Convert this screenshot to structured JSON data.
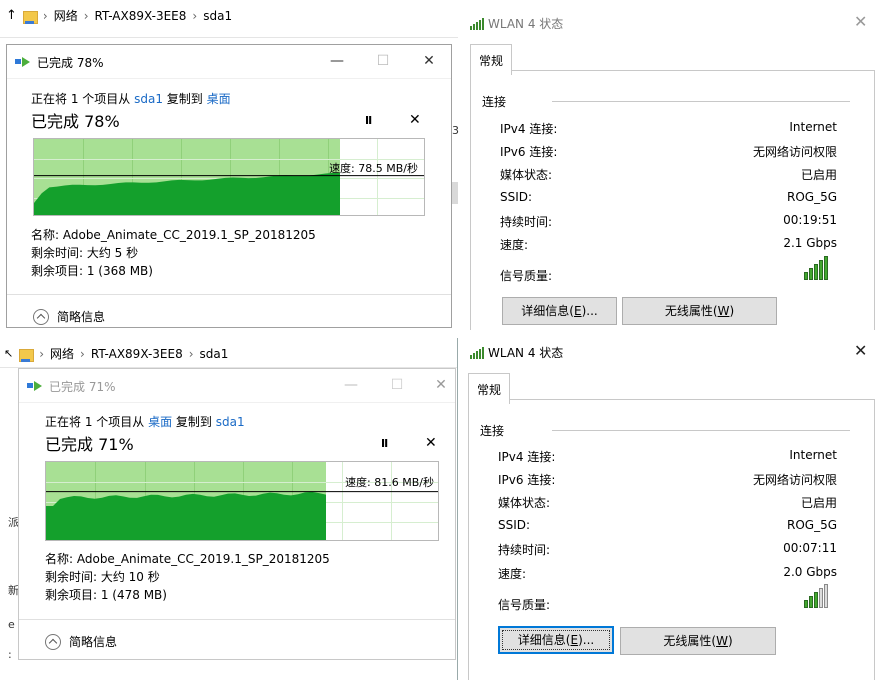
{
  "top": {
    "explorer": {
      "up_glyph": "↑",
      "crumbs": [
        "网络",
        "RT-AX89X-3EE8",
        "sda1"
      ]
    },
    "copy": {
      "title": "已完成 78%",
      "line_pre": "正在将 1 个项目从 ",
      "src": "sda1",
      "mid": " 复制到 ",
      "dst": "桌面",
      "big": "已完成 78%",
      "progress": 0.78,
      "speed_label": "速度: 78.5 MB/秒",
      "name": "名称: Adobe_Animate_CC_2019.1_SP_20181205",
      "remain_time": "剩余时间: 大约 5 秒",
      "remain_items": "剩余项目: 1 (368 MB)",
      "less_label": "简略信息",
      "minimize": "—",
      "maximize": "☐",
      "close": "✕",
      "pause": "II",
      "cancel": "✕"
    },
    "wlan": {
      "title": "WLAN 4 状态",
      "close": "✕",
      "tab": "常规",
      "group": "连接",
      "rows": [
        {
          "label": "IPv4 连接:",
          "value": "Internet"
        },
        {
          "label": "IPv6 连接:",
          "value": "无网络访问权限"
        },
        {
          "label": "媒体状态:",
          "value": "已启用"
        },
        {
          "label": "SSID:",
          "value": "ROG_5G"
        },
        {
          "label": "持续时间:",
          "value": "00:19:51"
        },
        {
          "label": "速度:",
          "value": "2.1 Gbps"
        }
      ],
      "signal_label": "信号质量:",
      "signal_bars": 5,
      "btn_details_pre": "详细信息(",
      "btn_details_key": "E",
      "btn_details_post": ")...",
      "btn_wireless_pre": "无线属性(",
      "btn_wireless_key": "W",
      "btn_wireless_post": ")"
    },
    "stray": "3"
  },
  "bottom": {
    "explorer": {
      "up_glyph": "↖",
      "crumbs": [
        "网络",
        "RT-AX89X-3EE8",
        "sda1"
      ]
    },
    "copy": {
      "title": "已完成 71%",
      "line_pre": "正在将 1 个项目从 ",
      "src": "桌面",
      "mid": " 复制到 ",
      "dst": "sda1",
      "big": "已完成 71%",
      "progress": 0.71,
      "speed_label": "速度: 81.6 MB/秒",
      "name": "名称: Adobe_Animate_CC_2019.1_SP_20181205",
      "remain_time": "剩余时间: 大约 10 秒",
      "remain_items": "剩余项目: 1 (478 MB)",
      "less_label": "简略信息",
      "minimize": "—",
      "maximize": "☐",
      "close": "✕",
      "pause": "II",
      "cancel": "✕"
    },
    "wlan": {
      "title": "WLAN 4 状态",
      "close": "✕",
      "tab": "常规",
      "group": "连接",
      "rows": [
        {
          "label": "IPv4 连接:",
          "value": "Internet"
        },
        {
          "label": "IPv6 连接:",
          "value": "无网络访问权限"
        },
        {
          "label": "媒体状态:",
          "value": "已启用"
        },
        {
          "label": "SSID:",
          "value": "ROG_5G"
        },
        {
          "label": "持续时间:",
          "value": "00:07:11"
        },
        {
          "label": "速度:",
          "value": "2.0 Gbps"
        }
      ],
      "signal_label": "信号质量:",
      "signal_bars": 3,
      "btn_details_pre": "详细信息(",
      "btn_details_key": "E",
      "btn_details_post": ")...",
      "btn_wireless_pre": "无线属性(",
      "btn_wireless_key": "W",
      "btn_wireless_post": ")"
    },
    "stray": [
      "派",
      "新",
      "e",
      ":"
    ]
  }
}
